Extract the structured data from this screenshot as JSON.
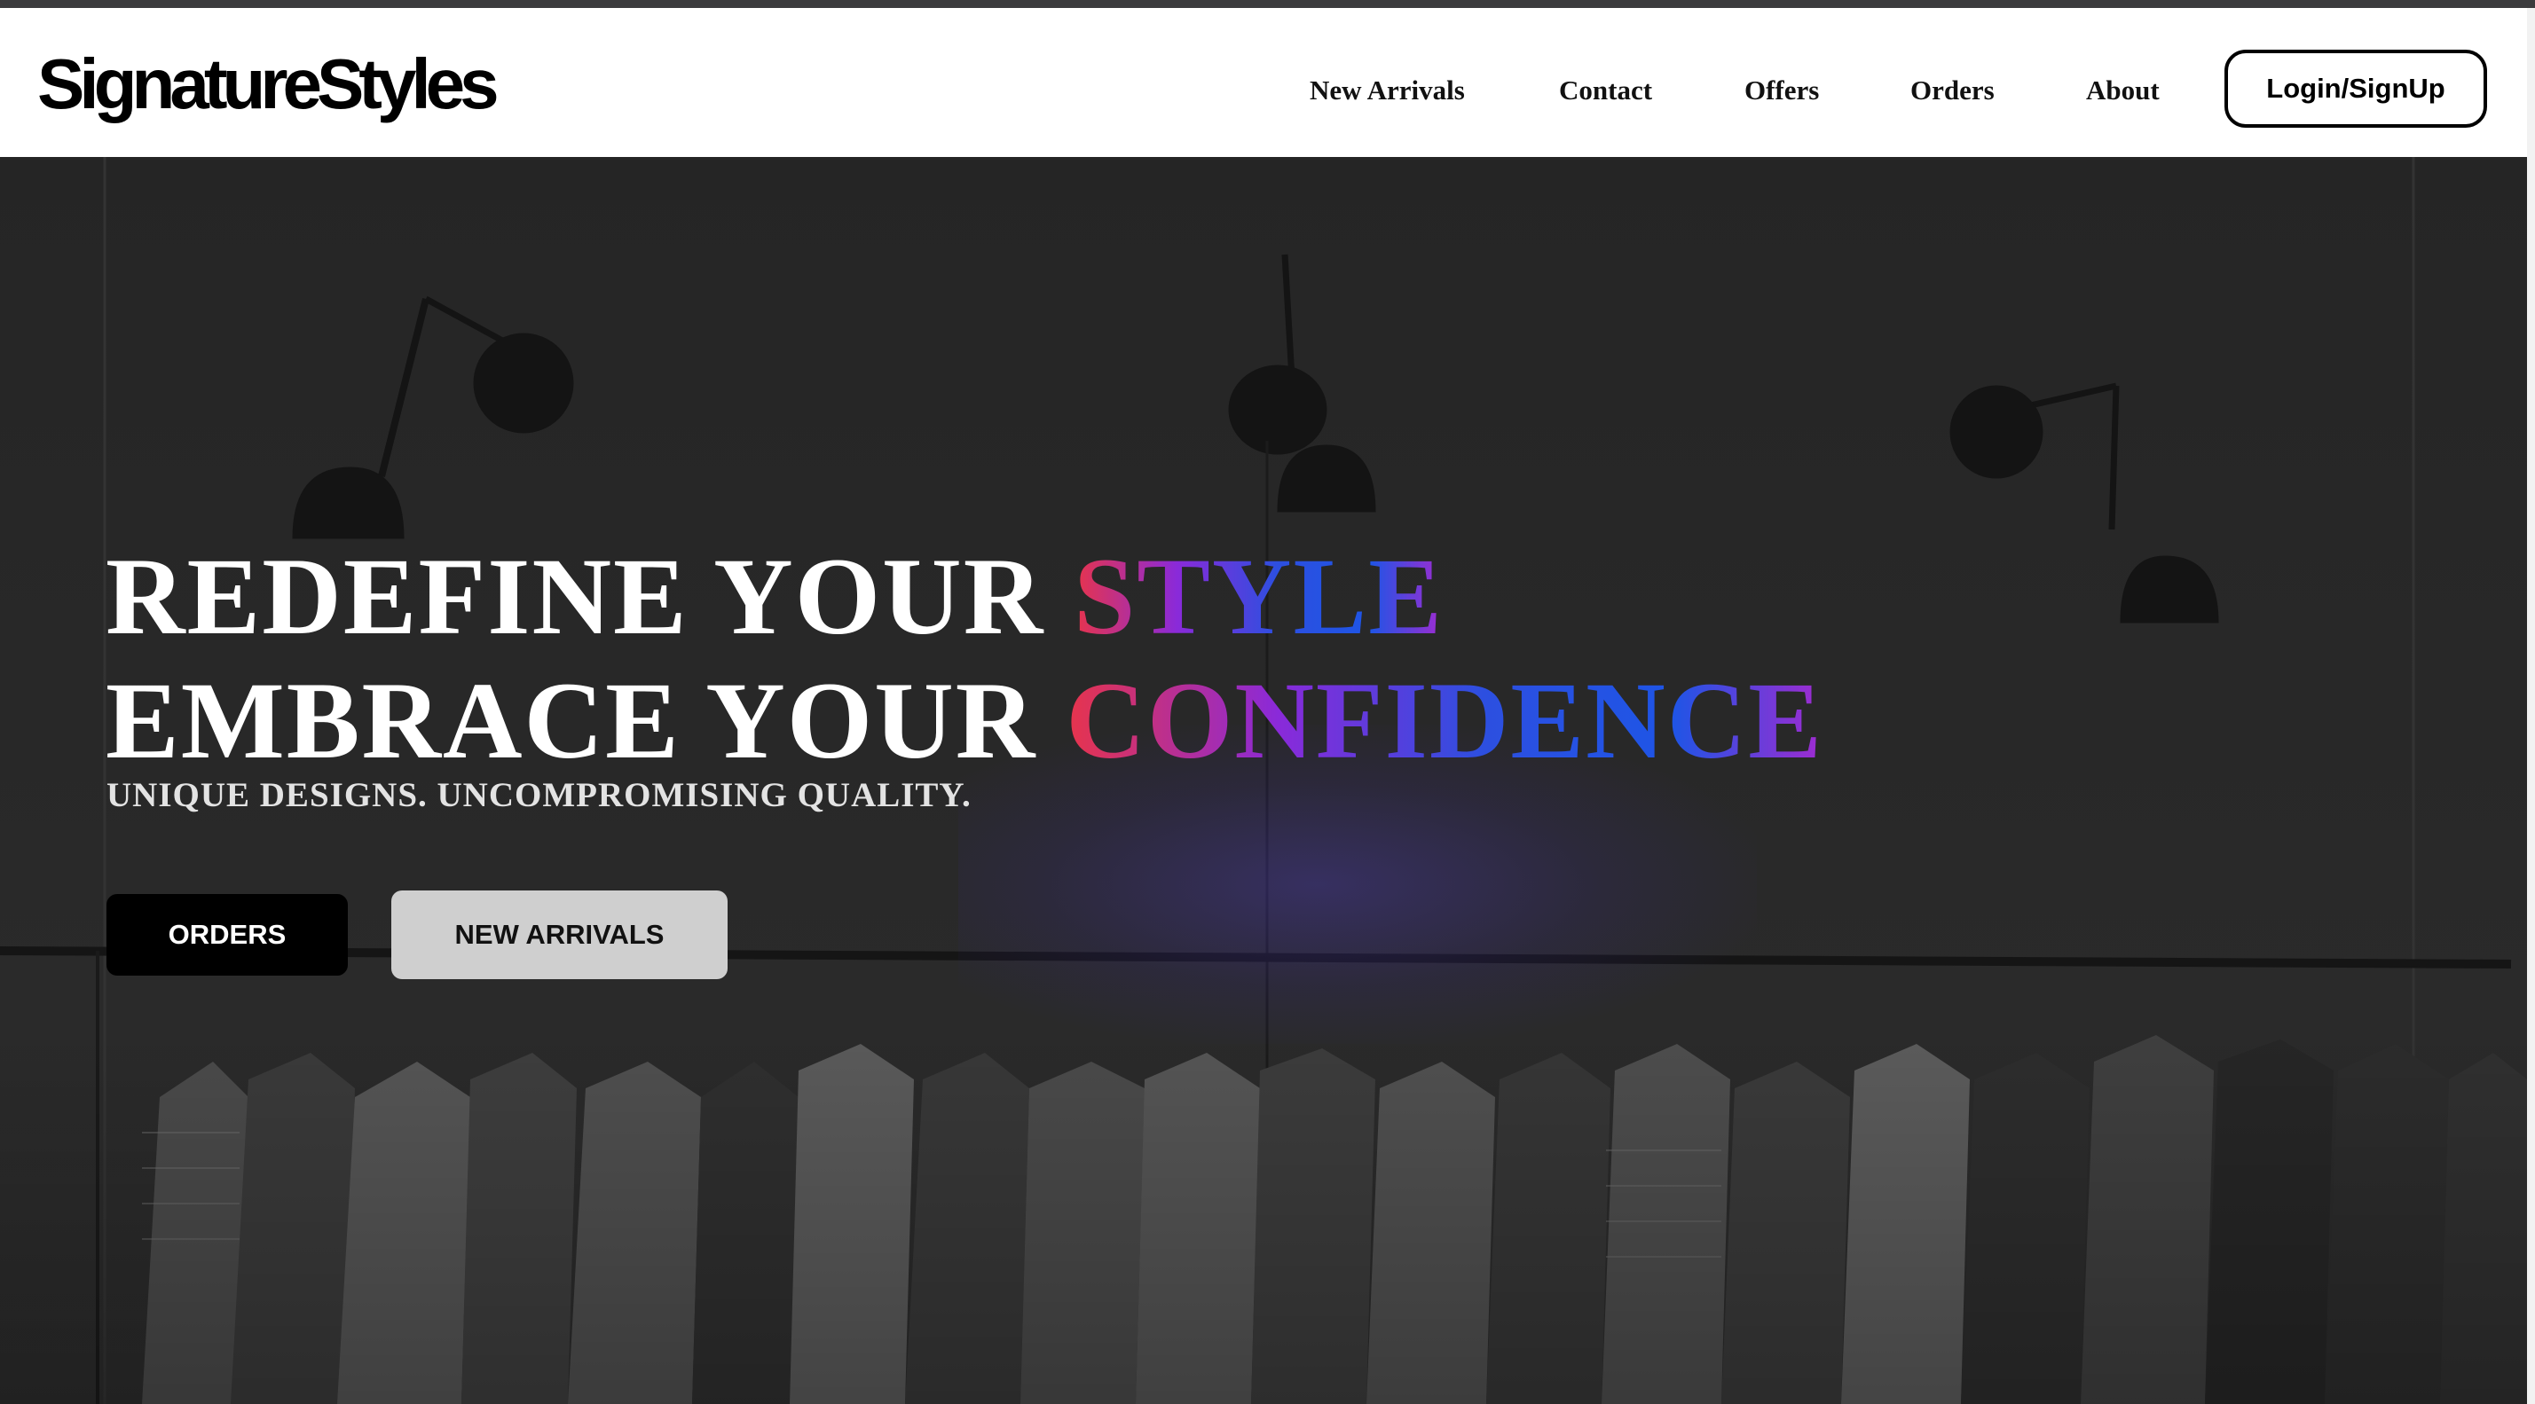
{
  "brand": {
    "logo": "SignatureStyles"
  },
  "nav": {
    "links": [
      "New Arrivals",
      "Contact",
      "Offers",
      "Orders",
      "About"
    ],
    "login_label": "Login/SignUp"
  },
  "hero": {
    "line1_prefix": "REDEFINE YOUR ",
    "line1_highlight": "STYLE",
    "line2_prefix": "EMBRACE YOUR ",
    "line2_highlight": "CONFIDENCE",
    "subtitle": "UNIQUE DESIGNS. UNCOMPROMISING QUALITY.",
    "orders_button": "ORDERS",
    "new_arrivals_button": "NEW ARRIVALS"
  },
  "colors": {
    "navbar_bg": "#ffffff",
    "hero_overlay": "#2a2a2a",
    "gradient_start": "#e8344b",
    "gradient_mid": "#8a2ad9",
    "gradient_end": "#1e55e6",
    "orders_button_bg": "#000000",
    "new_arrivals_button_bg": "#cfcfcf"
  }
}
